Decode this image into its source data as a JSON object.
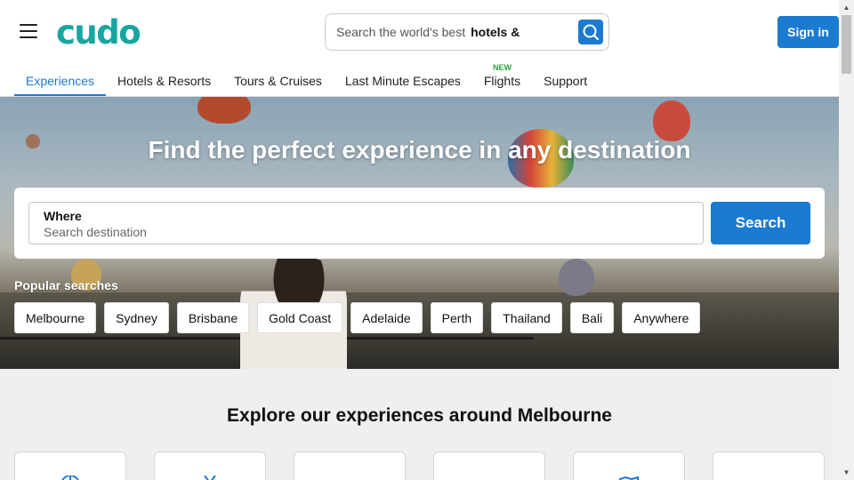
{
  "header": {
    "logo": "cudo",
    "search": {
      "prefix": "Search the world's best",
      "highlight": "hotels &"
    },
    "signin_label": "Sign in"
  },
  "nav": {
    "items": [
      {
        "label": "Experiences",
        "active": true,
        "badge": ""
      },
      {
        "label": "Hotels & Resorts",
        "active": false,
        "badge": ""
      },
      {
        "label": "Tours & Cruises",
        "active": false,
        "badge": ""
      },
      {
        "label": "Last Minute Escapes",
        "active": false,
        "badge": ""
      },
      {
        "label": "Flights",
        "active": false,
        "badge": "NEW"
      },
      {
        "label": "Support",
        "active": false,
        "badge": ""
      }
    ]
  },
  "hero": {
    "title": "Find the perfect experience in any destination",
    "where_label": "Where",
    "where_placeholder": "Search destination",
    "search_label": "Search",
    "popular_label": "Popular searches",
    "chips": [
      "Melbourne",
      "Sydney",
      "Brisbane",
      "Gold Coast",
      "Adelaide",
      "Perth",
      "Thailand",
      "Bali",
      "Anywhere"
    ]
  },
  "explore": {
    "title": "Explore our experiences around Melbourne",
    "cards": [
      "globe-icon",
      "utensils-icon",
      "mountain-icon",
      "pin-icon",
      "map-icon",
      "blank"
    ]
  },
  "colors": {
    "brand": "#16a6a1",
    "accent": "#1c7ad1",
    "badge": "#2aa43b"
  }
}
